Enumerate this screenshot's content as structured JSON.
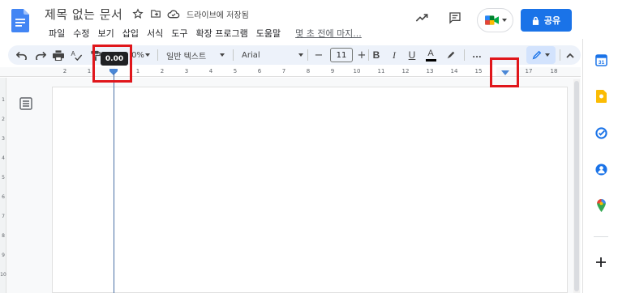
{
  "header": {
    "title": "제목 없는 문서",
    "save_status": "드라이브에 저장됨",
    "share_label": "공유"
  },
  "menu": {
    "items": [
      "파일",
      "수정",
      "보기",
      "삽입",
      "서식",
      "도구",
      "확장 프로그램",
      "도움말"
    ],
    "last_edit": "몇 초 전에 마지..."
  },
  "toolbar": {
    "zoom_partial": "0%",
    "style": "일반 텍스트",
    "font": "Arial",
    "font_size": "11",
    "more": "...",
    "bold": "B",
    "italic": "I",
    "underline": "U",
    "text_color": "A"
  },
  "ruler": {
    "tooltip": "0.00",
    "numbers": [
      "2",
      "1",
      "1",
      "2",
      "3",
      "4",
      "5",
      "6",
      "7",
      "8",
      "9",
      "10",
      "11",
      "12",
      "13",
      "14",
      "15",
      "17",
      "18"
    ]
  },
  "vertical_ruler": {
    "numbers": [
      "1",
      "2",
      "3",
      "4",
      "5",
      "6",
      "7",
      "8",
      "9",
      "10"
    ]
  },
  "colors": {
    "accent": "#1a73e8",
    "toolbar_bg": "#edf2fa",
    "highlight_box": "#e0161b",
    "guide_line": "#4a6fa5"
  },
  "icons": {
    "sidebar": [
      "calendar-icon",
      "keep-icon",
      "tasks-icon",
      "contacts-icon",
      "maps-icon",
      "add-icon"
    ]
  }
}
